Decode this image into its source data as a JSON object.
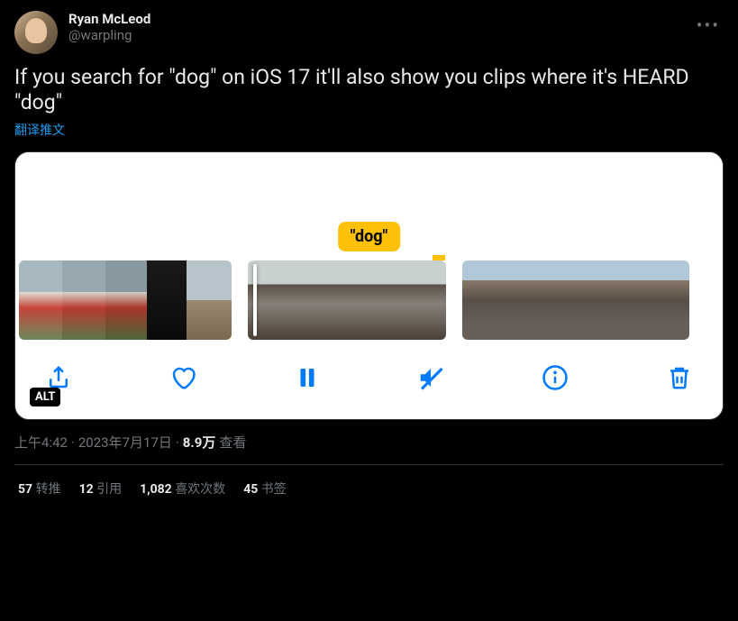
{
  "author": {
    "display_name": "Ryan McLeod",
    "handle": "@warpling"
  },
  "tweet_text": "If you search for \"dog\" on iOS 17 it'll also show you clips where it's HEARD \"dog\"",
  "translate_label": "翻译推文",
  "media": {
    "search_label": "\"dog\"",
    "alt_badge": "ALT"
  },
  "meta": {
    "time": "上午4:42",
    "date": "2023年7月17日",
    "views_count": "8.9万",
    "views_label": "查看"
  },
  "stats": {
    "retweets_count": "57",
    "retweets_label": "转推",
    "quotes_count": "12",
    "quotes_label": "引用",
    "likes_count": "1,082",
    "likes_label": "喜欢次数",
    "bookmarks_count": "45",
    "bookmarks_label": "书签"
  }
}
